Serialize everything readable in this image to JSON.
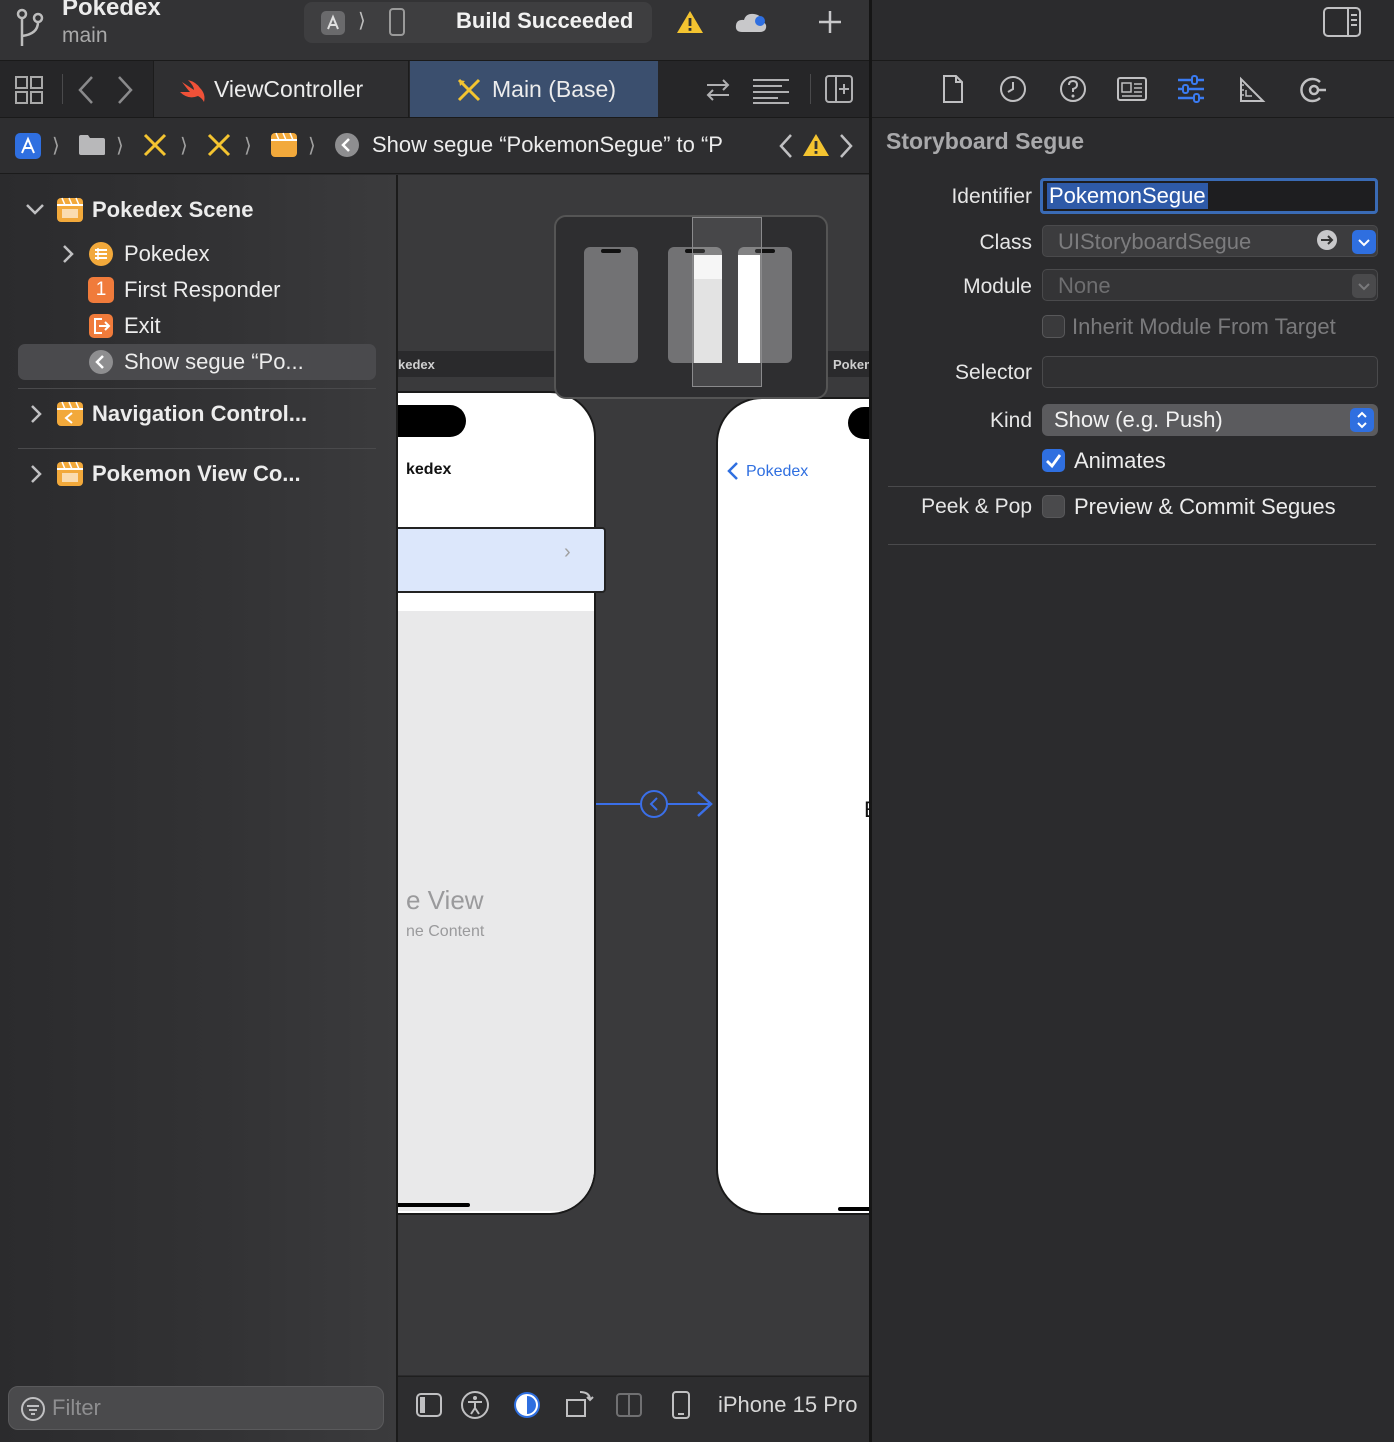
{
  "toolbar": {
    "project_name": "Pokedex",
    "branch": "main",
    "status": "Build Succeeded"
  },
  "tabs": [
    {
      "label": "ViewController"
    },
    {
      "label": "Main (Base)"
    }
  ],
  "jump_bar": {
    "crumb_text": "Show segue “PokemonSegue” to “P"
  },
  "outline": {
    "items": [
      {
        "label": "Pokedex Scene"
      },
      {
        "label": "Pokedex"
      },
      {
        "label": "First Responder"
      },
      {
        "label": "Exit"
      },
      {
        "label": "Show segue “Po..."
      },
      {
        "label": "Navigation Control..."
      },
      {
        "label": "Pokemon View Co..."
      }
    ],
    "first_responder_badge": "1",
    "filter_placeholder": "Filter"
  },
  "canvas": {
    "scene1_title_fragment": "kedex",
    "scene1_header": "kedex",
    "scene1_placeholder_title": "e View",
    "scene1_placeholder_sub": "ne Content",
    "scene2_title_fragment": "Pokem",
    "back_button": "Pokedex",
    "scene2_edge_char": "E",
    "device": "iPhone 15 Pro"
  },
  "inspector": {
    "title": "Storyboard Segue",
    "identifier_label": "Identifier",
    "identifier_value": "PokemonSegue",
    "class_label": "Class",
    "class_placeholder": "UIStoryboardSegue",
    "module_label": "Module",
    "module_placeholder": "None",
    "inherit_label": "Inherit Module From Target",
    "selector_label": "Selector",
    "kind_label": "Kind",
    "kind_value": "Show (e.g. Push)",
    "animates_label": "Animates",
    "animates_checked": true,
    "peek_label": "Peek & Pop",
    "peek_option": "Preview & Commit Segues",
    "peek_checked": false
  },
  "colors": {
    "accent": "#2f6fe0",
    "warning": "#f4c430",
    "storyboard_icon": "#f2a93b"
  }
}
